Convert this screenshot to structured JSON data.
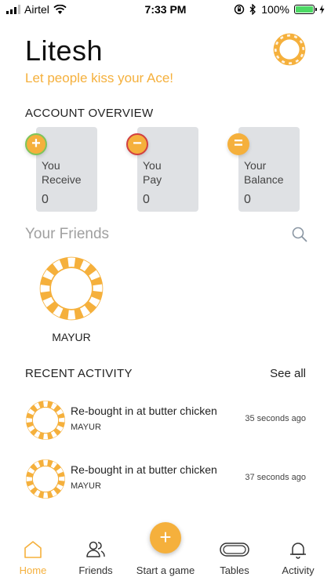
{
  "status_bar": {
    "carrier": "Airtel",
    "time": "7:33 PM",
    "battery": "100%"
  },
  "profile": {
    "name": "Litesh",
    "tagline": "Let people kiss your Ace!"
  },
  "account_overview": {
    "title": "ACCOUNT OVERVIEW",
    "cards": [
      {
        "symbol": "+",
        "label_line1": "You",
        "label_line2": "Receive",
        "value": "0"
      },
      {
        "symbol": "−",
        "label_line1": "You",
        "label_line2": "Pay",
        "value": "0"
      },
      {
        "symbol": "=",
        "label_line1": "Your",
        "label_line2": "Balance",
        "value": "0"
      }
    ]
  },
  "friends": {
    "title": "Your Friends",
    "items": [
      {
        "name": "MAYUR"
      }
    ]
  },
  "recent_activity": {
    "title": "RECENT ACTIVITY",
    "see_all": "See all",
    "items": [
      {
        "text": "Re-bought in at butter chicken",
        "user": "MAYUR",
        "time": "35 seconds ago"
      },
      {
        "text": "Re-bought in at butter chicken",
        "user": "MAYUR",
        "time": "37 seconds ago"
      }
    ]
  },
  "tab_bar": {
    "home": "Home",
    "friends": "Friends",
    "start_game": "Start a game",
    "start_game_symbol": "+",
    "tables": "Tables",
    "activity": "Activity"
  },
  "colors": {
    "accent": "#f5b03c",
    "card_bg": "#dfe1e4",
    "receive_ring": "#7ec55a",
    "pay_ring": "#d24040"
  },
  "icons": [
    "signal-icon",
    "wifi-icon",
    "orientation-lock-icon",
    "bluetooth-icon",
    "battery-icon",
    "charging-icon",
    "poker-chip-icon",
    "search-icon",
    "home-icon",
    "friends-icon",
    "table-icon",
    "bell-icon"
  ]
}
